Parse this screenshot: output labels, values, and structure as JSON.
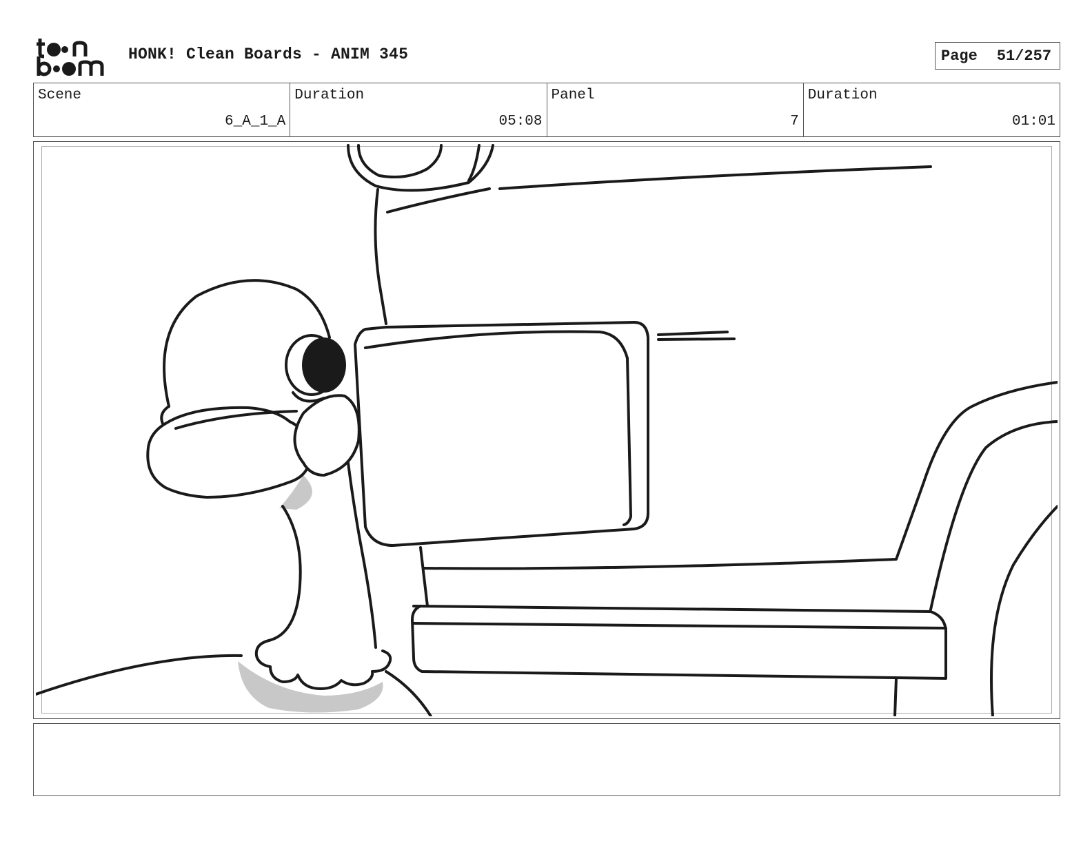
{
  "header": {
    "logo_text": "toon boom",
    "title": "HONK! Clean Boards - ANIM 345",
    "page_label": "Page",
    "page_number": "51/257"
  },
  "info": [
    {
      "label": "Scene",
      "value": "6_A_1_A"
    },
    {
      "label": "Duration",
      "value": "05:08"
    },
    {
      "label": "Panel",
      "value": "7"
    },
    {
      "label": "Duration",
      "value": "01:01"
    }
  ],
  "panel": {
    "image": "storyboard-drawing: goose peeking from behind a car side mirror"
  },
  "notes": {
    "text": ""
  }
}
